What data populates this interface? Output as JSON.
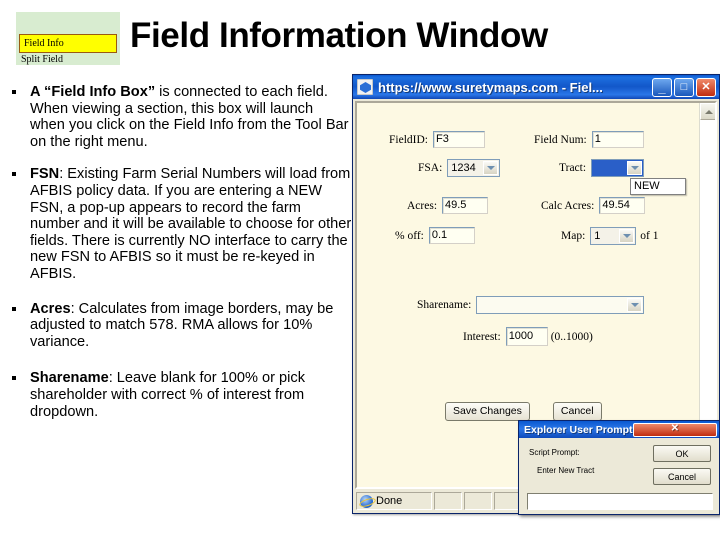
{
  "slide": {
    "title": "Field Information Window",
    "green_box": {
      "button_label": "Field Info",
      "clipped_label": "Split Field"
    },
    "bullets": [
      {
        "lead": "A “Field Info Box”",
        "rest": " is connected to each field. When viewing a section, this box will launch when you click on the Field Info from the Tool Bar on the right menu."
      },
      {
        "lead": "FSN",
        "rest": ": Existing Farm Serial Numbers will load from AFBIS policy data.  If you are entering a NEW FSN, a pop-up appears to record the farm number and it will be available to choose for other fields. There is currently NO interface to carry the new  FSN to AFBIS so it must be re-keyed in AFBIS."
      },
      {
        "lead": "Acres",
        "rest": ": Calculates from image borders, may be adjusted to match 578. RMA allows for 10% variance."
      },
      {
        "lead": "Sharename",
        "rest": ": Leave blank for 100% or pick shareholder with correct % of interest from dropdown."
      }
    ]
  },
  "browser": {
    "title": "https://www.suretymaps.com - Fiel...",
    "window_buttons": {
      "minimize": "_",
      "maximize": "□",
      "close": "✕"
    },
    "status": {
      "done_label": "Done",
      "zone_label": ""
    }
  },
  "form": {
    "field_id": {
      "label": "FieldID:",
      "value": "F3"
    },
    "field_num": {
      "label": "Field Num:",
      "value": "1"
    },
    "fsa": {
      "label": "FSA:",
      "value": "1234"
    },
    "tract": {
      "label": "Tract:",
      "value": "",
      "open_option": "NEW"
    },
    "acres": {
      "label": "Acres:",
      "value": "49.5"
    },
    "calc_acres": {
      "label": "Calc Acres:",
      "value": "49.54"
    },
    "pct_off": {
      "label": "% off:",
      "value": "0.1"
    },
    "map": {
      "label": "Map:",
      "value": "1",
      "suffix": "of 1"
    },
    "sharename": {
      "label": "Sharename:",
      "value": ""
    },
    "interest": {
      "label": "Interest:",
      "value": "1000",
      "hint": "(0..1000)"
    },
    "save_button": "Save Changes",
    "cancel_button": "Cancel"
  },
  "prompt_dialog": {
    "title": "Explorer User Prompt",
    "script_label": "Script Prompt:",
    "message": "Enter New Tract",
    "ok_button": "OK",
    "cancel_button": "Cancel",
    "input_value": ""
  },
  "colors": {
    "title_bar_blue": "#1257c9",
    "form_background": "#fdf9e3",
    "highlight_blue": "#2a5fc8",
    "green_box": "#d8ecd0",
    "yellow_button": "#ffff00"
  }
}
